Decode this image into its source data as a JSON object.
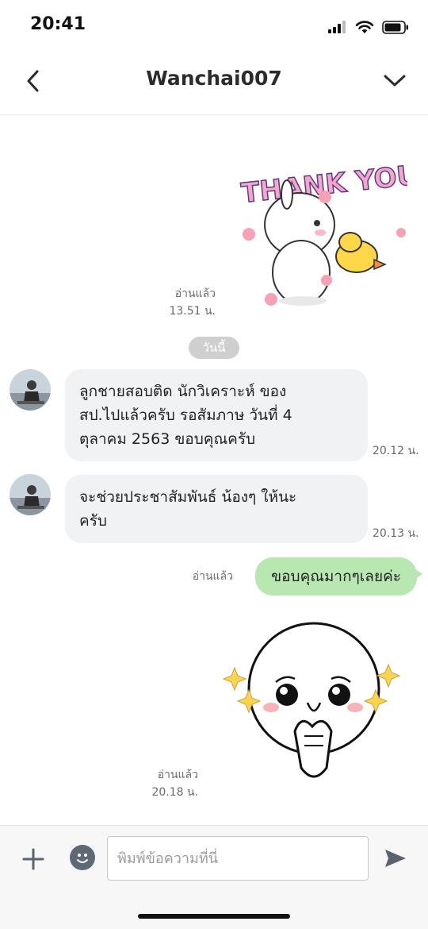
{
  "status_bar": {
    "time": "20:41",
    "icons": [
      "signal-icon",
      "wifi-icon",
      "battery-icon"
    ]
  },
  "header": {
    "title": "Wanchai007",
    "back_icon": "chevron-left-icon",
    "menu_icon": "chevron-down-icon"
  },
  "messages": [
    {
      "type": "sticker",
      "direction": "outgoing",
      "sticker": "thank-you-rabbit-sticker",
      "read_label": "อ่านแล้ว",
      "time": "13.51 น."
    },
    {
      "type": "date_separator",
      "text": "วันนี้"
    },
    {
      "type": "text",
      "direction": "incoming",
      "lines": [
        "ลูกชายสอบติด นักวิเคราะห์ ของ",
        "สป.ไปแล้วครับ รอสัมภาษ วันที่ 4",
        "ตุลาคม 2563  ขอบคุณครับ"
      ],
      "time": "20.12 น."
    },
    {
      "type": "text",
      "direction": "incoming",
      "lines": [
        "จะช่วยประชาสัมพันธ์ น้องๆ ให้นะ",
        "ครับ"
      ],
      "time": "20.13 น."
    },
    {
      "type": "text",
      "direction": "outgoing",
      "text": "ขอบคุณมากๆเลยค่ะ",
      "read_label": "อ่านแล้ว"
    },
    {
      "type": "sticker",
      "direction": "outgoing",
      "sticker": "pleading-moon-face-sticker",
      "read_label": "อ่านแล้ว",
      "time": "20.18 น."
    }
  ],
  "input_bar": {
    "placeholder": "พิมพ์ข้อความที่นี่",
    "value": "",
    "plus_icon": "plus-icon",
    "emoji_icon": "emoji-icon",
    "send_icon": "send-icon"
  },
  "colors": {
    "outgoing_bubble": "#b9e7b2",
    "incoming_bubble": "#f1f2f4",
    "date_chip": "#cfcfcf"
  }
}
